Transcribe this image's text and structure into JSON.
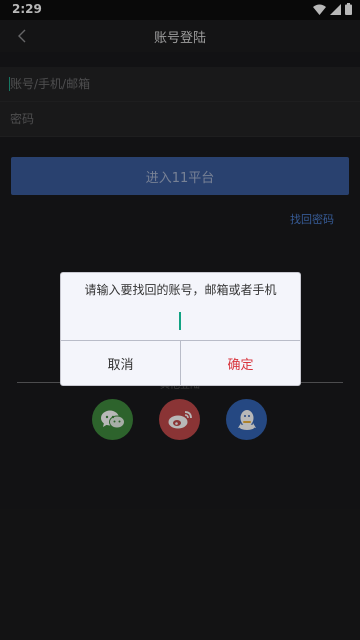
{
  "status_bar": {
    "time": "2:29"
  },
  "header": {
    "title": "账号登陆"
  },
  "form": {
    "account_placeholder": "账号/手机/邮箱",
    "password_placeholder": "密码",
    "login_button": "进入11平台",
    "forgot_link": "找回密码"
  },
  "social": {
    "label": "其他登陆",
    "items": [
      "wechat-icon",
      "weibo-icon",
      "qq-icon"
    ]
  },
  "dialog": {
    "message": "请输入要找回的账号，邮箱或者手机",
    "input_value": "",
    "cancel": "取消",
    "confirm": "确定"
  },
  "colors": {
    "background": "#1a1a1c",
    "primary_button": "#3a5a9a",
    "link": "#4c7ed0",
    "wechat": "#3f8a3e",
    "weibo": "#c0494a",
    "qq": "#3464b4",
    "confirm": "#d8343c"
  }
}
